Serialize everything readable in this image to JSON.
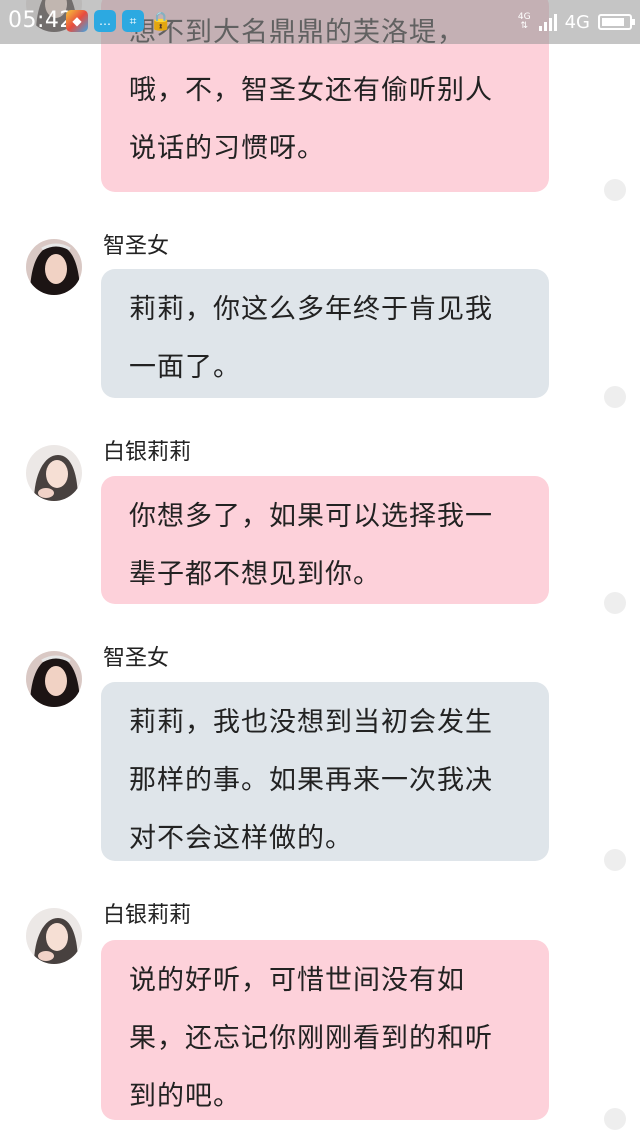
{
  "status_bar": {
    "time": "05:42",
    "network_small": "4G",
    "network_label": "4G",
    "battery_level": 0.85
  },
  "messages": [
    {
      "sender": "",
      "lines": [
        "想不到大名鼎鼎的芙洛堤，",
        "哦，不，智圣女还有偷听别人",
        "说话的习惯呀。"
      ],
      "bubble_color": "#fdd1da"
    },
    {
      "sender": "智圣女",
      "lines": [
        "莉莉，你这么多年终于肯见我",
        "一面了。"
      ],
      "bubble_color": "#dfe5ea"
    },
    {
      "sender": "白银莉莉",
      "lines": [
        "你想多了，如果可以选择我一",
        "辈子都不想见到你。"
      ],
      "bubble_color": "#fdd1da"
    },
    {
      "sender": "智圣女",
      "lines": [
        "莉莉，我也没想到当初会发生",
        "那样的事。如果再来一次我决",
        "对不会这样做的。"
      ],
      "bubble_color": "#dfe5ea"
    },
    {
      "sender": "白银莉莉",
      "lines": [
        "说的好听，可惜世间没有如",
        "果，还忘记你刚刚看到的和听",
        "到的吧。"
      ],
      "bubble_color": "#fdd1da"
    }
  ]
}
